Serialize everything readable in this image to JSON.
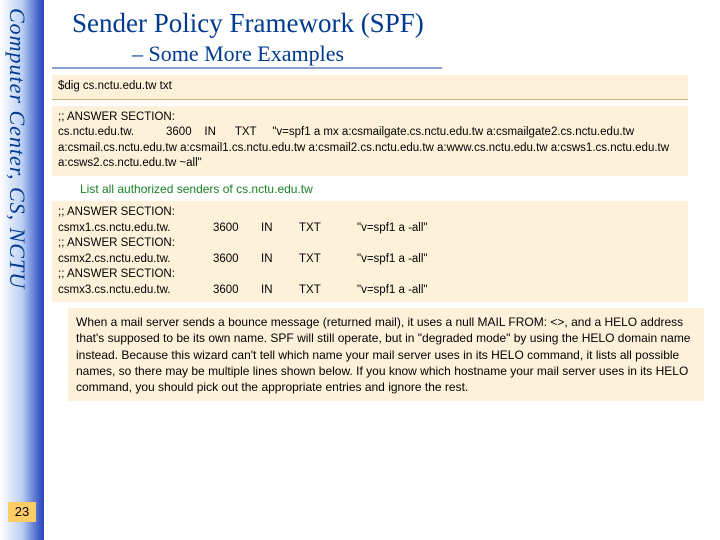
{
  "sidebar": {
    "label": "Computer Center, CS, NCTU",
    "page": "23"
  },
  "header": {
    "title": "Sender Policy Framework (SPF)",
    "subtitle": "– Some More Examples"
  },
  "cmd": "$dig cs.nctu.edu.tw txt",
  "answer1": ";; ANSWER SECTION:\ncs.nctu.edu.tw.          3600    IN      TXT     \"v=spf1 a mx a:csmailgate.cs.nctu.edu.tw a:csmailgate2.cs.nctu.edu.tw a:csmail.cs.nctu.edu.tw a:csmail1.cs.nctu.edu.tw a:csmail2.cs.nctu.edu.tw a:www.cs.nctu.edu.tw a:csws1.cs.nctu.edu.tw a:csws2.cs.nctu.edu.tw ~all\"",
  "note1": "List all authorized senders of cs.nctu.edu.tw",
  "answer2": {
    "rows": [
      {
        "header": ";; ANSWER SECTION:",
        "host": "csmx1.cs.nctu.edu.tw.",
        "ttl": "3600",
        "in": "IN",
        "type": "TXT",
        "value": "\"v=spf1 a -all\""
      },
      {
        "header": ";; ANSWER SECTION:",
        "host": "csmx2.cs.nctu.edu.tw.",
        "ttl": "3600",
        "in": "IN",
        "type": "TXT",
        "value": "\"v=spf1 a -all\""
      },
      {
        "header": ";; ANSWER SECTION:",
        "host": "csmx3.cs.nctu.edu.tw.",
        "ttl": "3600",
        "in": "IN",
        "type": "TXT",
        "value": "\"v=spf1 a -all\""
      }
    ]
  },
  "note2": "When a mail server sends a bounce message (returned mail), it uses a null MAIL FROM: <>, and a HELO address that's supposed to be its own name. SPF will still operate, but in \"degraded mode\" by using the HELO domain name instead. Because this wizard can't tell which name your mail server uses in its HELO command, it lists all possible names, so there may be multiple lines shown below. If you know which hostname your mail server uses in its HELO command, you should pick out the appropriate entries and ignore the rest."
}
